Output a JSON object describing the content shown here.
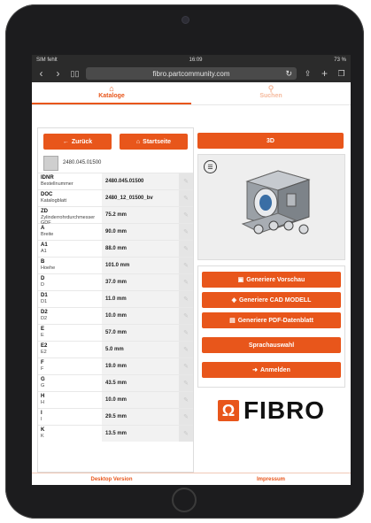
{
  "status": {
    "carrier": "SIM fehlt",
    "time": "16:09",
    "battery": "73 %"
  },
  "browser": {
    "url": "fibro.partcommunity.com",
    "back_icon": "back-icon",
    "forward_icon": "forward-icon"
  },
  "tabs": [
    {
      "label": "Kataloge",
      "icon": "home-icon"
    },
    {
      "label": "Suchen",
      "icon": "search-icon"
    }
  ],
  "nav": {
    "back_label": "Zurück",
    "start_label": "Startseite"
  },
  "product": {
    "number": "2480.045.01500"
  },
  "table": [
    {
      "key": "IDNR",
      "desc": "Bestellnummer",
      "value": "2480.045.01500"
    },
    {
      "key": "DOC",
      "desc": "Katalogblatt",
      "value": "2480_12_01500_bv"
    },
    {
      "key": "ZD",
      "desc": "Zylinderrohrdurchmesser GDF",
      "value": "75.2 mm"
    },
    {
      "key": "A",
      "desc": "Breite",
      "value": "90.0 mm"
    },
    {
      "key": "A1",
      "desc": "A1",
      "value": "88.0 mm"
    },
    {
      "key": "B",
      "desc": "Hoehe",
      "value": "101.0 mm"
    },
    {
      "key": "D",
      "desc": "D",
      "value": "37.0 mm"
    },
    {
      "key": "D1",
      "desc": "D1",
      "value": "11.0 mm"
    },
    {
      "key": "D2",
      "desc": "D2",
      "value": "10.0 mm"
    },
    {
      "key": "E",
      "desc": "E",
      "value": "57.0 mm"
    },
    {
      "key": "E2",
      "desc": "E2",
      "value": "5.0 mm"
    },
    {
      "key": "F",
      "desc": "F",
      "value": "19.0 mm"
    },
    {
      "key": "G",
      "desc": "G",
      "value": "43.5 mm"
    },
    {
      "key": "H",
      "desc": "H",
      "value": "10.0 mm"
    },
    {
      "key": "I",
      "desc": "I",
      "value": "29.5 mm"
    },
    {
      "key": "K",
      "desc": "K",
      "value": "13.5 mm"
    }
  ],
  "right": {
    "btn_3d": "3D",
    "actions": {
      "preview": "Generiere Vorschau",
      "cad": "Generiere CAD MODELL",
      "pdf": "Generiere PDF-Datenblatt",
      "language": "Sprachauswahl",
      "login": "Anmelden"
    },
    "logo_text": "FIBRO"
  },
  "footer": {
    "desktop": "Desktop Version",
    "impressum": "Impressum"
  },
  "colors": {
    "accent": "#e8561b"
  }
}
